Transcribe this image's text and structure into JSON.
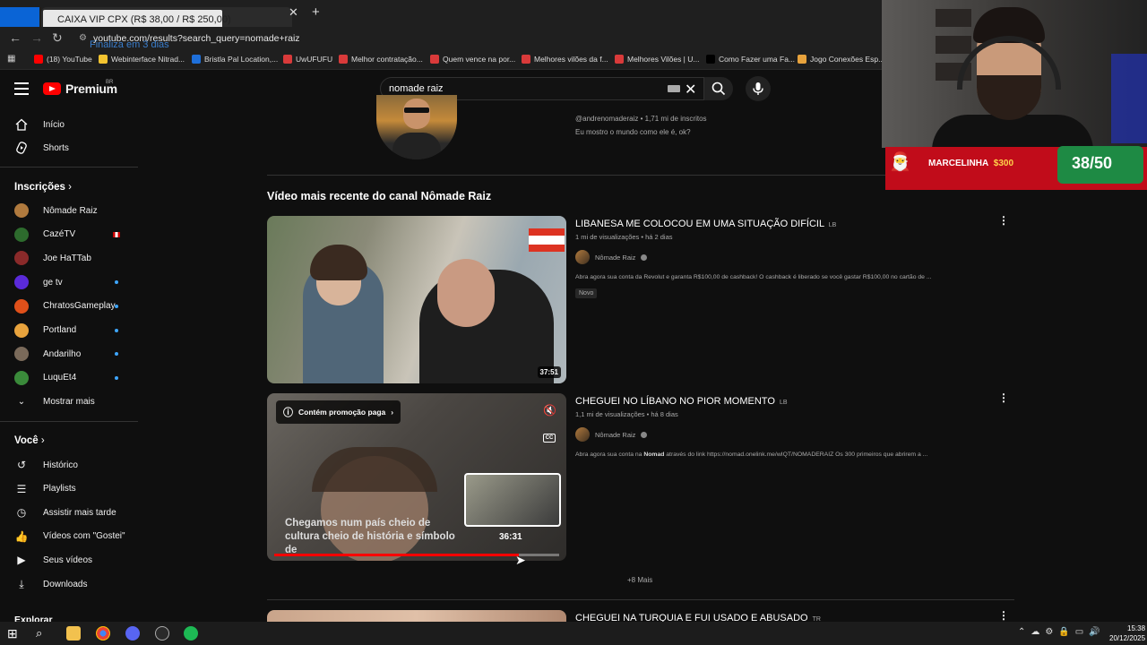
{
  "browser": {
    "tab_tooltip": "CAIXA VIP CPX (R$ 38,00 / R$ 250,00)",
    "address": "youtube.com/results?search_query=nomade+raiz",
    "overlay_text": "Finaliza em 3 dias",
    "bookmarks": [
      {
        "label": "(18) YouTube",
        "color": "#ff0000"
      },
      {
        "label": "Webinterface Nitrad...",
        "color": "#f4c430"
      },
      {
        "label": "Bristla Pal Location,...",
        "color": "#1e6fd9"
      },
      {
        "label": "UwUFUFU",
        "color": "#d93a3a"
      },
      {
        "label": "Melhor contratação...",
        "color": "#d93a3a"
      },
      {
        "label": "Quem vence na por...",
        "color": "#d93a3a"
      },
      {
        "label": "Melhores vilões da f...",
        "color": "#d93a3a"
      },
      {
        "label": "Melhores Vilões | U...",
        "color": "#d93a3a"
      },
      {
        "label": "Como Fazer uma Fa...",
        "color": "#000000"
      },
      {
        "label": "Jogo Conexões Esp...",
        "color": "#e8a33d"
      }
    ]
  },
  "youtube": {
    "logo_text": "Premium",
    "region": "BR",
    "search_value": "nomade raiz"
  },
  "sidebar": {
    "main": [
      {
        "label": "Início",
        "icon": "home-icon"
      },
      {
        "label": "Shorts",
        "icon": "shorts-icon"
      }
    ],
    "subscriptions_heading": "Inscrições",
    "subscriptions": [
      {
        "label": "Nômade Raiz",
        "color": "#b07a3e",
        "live": false
      },
      {
        "label": "CazéTV",
        "color": "#2d6b2d",
        "live": false,
        "flag": true
      },
      {
        "label": "Joe HaTTab",
        "color": "#8a2a2a",
        "live": false
      },
      {
        "label": "ge tv",
        "color": "#5a2ad9",
        "live": true
      },
      {
        "label": "ChratosGameplay",
        "color": "#e0501a",
        "live": true
      },
      {
        "label": "Portland",
        "color": "#e8a33d",
        "live": true
      },
      {
        "label": "Andarilho",
        "color": "#7a6a5a",
        "live": true
      },
      {
        "label": "LuquEt4",
        "color": "#3a8a3a",
        "live": true
      }
    ],
    "show_more": "Mostrar mais",
    "you_heading": "Você",
    "you": [
      {
        "label": "Histórico",
        "icon": "history-icon"
      },
      {
        "label": "Playlists",
        "icon": "playlists-icon"
      },
      {
        "label": "Assistir mais tarde",
        "icon": "watch-later-icon"
      },
      {
        "label": "Vídeos com \"Gostei\"",
        "icon": "like-icon"
      },
      {
        "label": "Seus vídeos",
        "icon": "your-videos-icon"
      },
      {
        "label": "Downloads",
        "icon": "download-icon"
      }
    ],
    "explore_heading": "Explorar"
  },
  "channel": {
    "handle_line": "@andrenomaderaiz • 1,71 mi de inscritos",
    "description": "Eu mostro o mundo como ele é, ok?"
  },
  "section_title": "Vídeo mais recente do canal Nômade Raiz",
  "videos": [
    {
      "title": "LIBANESA ME COLOCOU EM UMA SITUAÇÃO DIFÍCIL",
      "country": "LB",
      "meta": "1 mi de visualizações • há 2 dias",
      "channel": "Nômade Raiz",
      "description": "Abra agora sua conta da Revolut e garanta R$100,00 de cashback! O cashback é liberado se você gastar R$100,00 no cartão de ...",
      "badge": "Novo",
      "duration": "37:51"
    },
    {
      "title": "CHEGUEI NO LÍBANO NO PIOR MOMENTO",
      "country": "LB",
      "meta": "1,1 mi de visualizações • há 8 dias",
      "channel": "Nômade Raiz",
      "description_prefix": "Abra agora sua conta na ",
      "description_bold": "Nomad",
      "description_rest": " através do link https://nomad.onelink.me/wIQT/NOMADERAIZ Os 300 primeiros que abrirem a ...",
      "promo_chip": "Contém promoção paga",
      "caption": "Chegamos num país cheio de cultura cheio de história e símbolo de",
      "preview_time": "36:31",
      "progress": 0.86
    },
    {
      "title": "CHEGUEI NA TURQUIA E FUI USADO E ABUSADO",
      "country": "TR"
    }
  ],
  "more_link": "+8 Mais",
  "stream_overlay": {
    "donor": "MARCELINHA",
    "amount": "$300",
    "counter": "38/50"
  },
  "taskbar": {
    "time": "15:38",
    "date": "20/12/2025"
  }
}
